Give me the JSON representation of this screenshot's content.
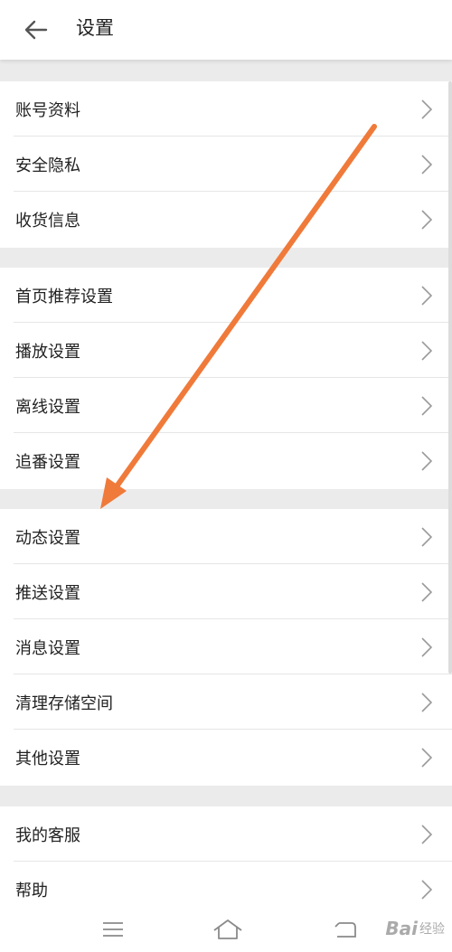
{
  "header": {
    "title": "设置",
    "back_icon": "back-arrow-icon"
  },
  "groups": [
    {
      "items": [
        "账号资料",
        "安全隐私",
        "收货信息"
      ]
    },
    {
      "items": [
        "首页推荐设置",
        "播放设置",
        "离线设置",
        "追番设置"
      ]
    },
    {
      "items": [
        "动态设置",
        "推送设置",
        "消息设置",
        "清理存储空间",
        "其他设置"
      ]
    },
    {
      "items": [
        "我的客服",
        "帮助"
      ]
    }
  ],
  "annotation": {
    "color": "#f07a3a",
    "description": "orange arrow pointing to 动态设置"
  },
  "navbar": {
    "icons": [
      "menu-icon",
      "home-icon",
      "back-icon"
    ]
  },
  "watermark": {
    "text": "Bai",
    "sub": "经验"
  }
}
